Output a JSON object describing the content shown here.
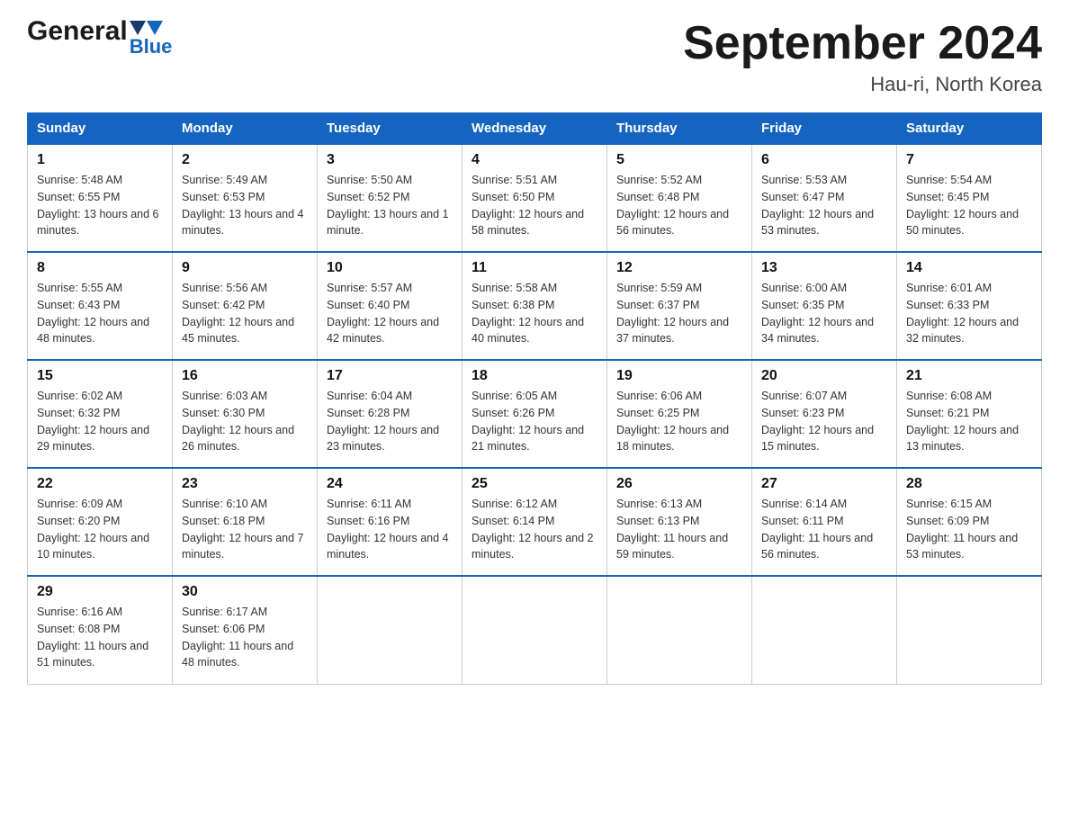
{
  "header": {
    "logo_general": "General",
    "logo_blue": "Blue",
    "title": "September 2024",
    "subtitle": "Hau-ri, North Korea"
  },
  "days_of_week": [
    "Sunday",
    "Monday",
    "Tuesday",
    "Wednesday",
    "Thursday",
    "Friday",
    "Saturday"
  ],
  "weeks": [
    [
      {
        "day": "1",
        "sunrise": "5:48 AM",
        "sunset": "6:55 PM",
        "daylight": "13 hours and 6 minutes."
      },
      {
        "day": "2",
        "sunrise": "5:49 AM",
        "sunset": "6:53 PM",
        "daylight": "13 hours and 4 minutes."
      },
      {
        "day": "3",
        "sunrise": "5:50 AM",
        "sunset": "6:52 PM",
        "daylight": "13 hours and 1 minute."
      },
      {
        "day": "4",
        "sunrise": "5:51 AM",
        "sunset": "6:50 PM",
        "daylight": "12 hours and 58 minutes."
      },
      {
        "day": "5",
        "sunrise": "5:52 AM",
        "sunset": "6:48 PM",
        "daylight": "12 hours and 56 minutes."
      },
      {
        "day": "6",
        "sunrise": "5:53 AM",
        "sunset": "6:47 PM",
        "daylight": "12 hours and 53 minutes."
      },
      {
        "day": "7",
        "sunrise": "5:54 AM",
        "sunset": "6:45 PM",
        "daylight": "12 hours and 50 minutes."
      }
    ],
    [
      {
        "day": "8",
        "sunrise": "5:55 AM",
        "sunset": "6:43 PM",
        "daylight": "12 hours and 48 minutes."
      },
      {
        "day": "9",
        "sunrise": "5:56 AM",
        "sunset": "6:42 PM",
        "daylight": "12 hours and 45 minutes."
      },
      {
        "day": "10",
        "sunrise": "5:57 AM",
        "sunset": "6:40 PM",
        "daylight": "12 hours and 42 minutes."
      },
      {
        "day": "11",
        "sunrise": "5:58 AM",
        "sunset": "6:38 PM",
        "daylight": "12 hours and 40 minutes."
      },
      {
        "day": "12",
        "sunrise": "5:59 AM",
        "sunset": "6:37 PM",
        "daylight": "12 hours and 37 minutes."
      },
      {
        "day": "13",
        "sunrise": "6:00 AM",
        "sunset": "6:35 PM",
        "daylight": "12 hours and 34 minutes."
      },
      {
        "day": "14",
        "sunrise": "6:01 AM",
        "sunset": "6:33 PM",
        "daylight": "12 hours and 32 minutes."
      }
    ],
    [
      {
        "day": "15",
        "sunrise": "6:02 AM",
        "sunset": "6:32 PM",
        "daylight": "12 hours and 29 minutes."
      },
      {
        "day": "16",
        "sunrise": "6:03 AM",
        "sunset": "6:30 PM",
        "daylight": "12 hours and 26 minutes."
      },
      {
        "day": "17",
        "sunrise": "6:04 AM",
        "sunset": "6:28 PM",
        "daylight": "12 hours and 23 minutes."
      },
      {
        "day": "18",
        "sunrise": "6:05 AM",
        "sunset": "6:26 PM",
        "daylight": "12 hours and 21 minutes."
      },
      {
        "day": "19",
        "sunrise": "6:06 AM",
        "sunset": "6:25 PM",
        "daylight": "12 hours and 18 minutes."
      },
      {
        "day": "20",
        "sunrise": "6:07 AM",
        "sunset": "6:23 PM",
        "daylight": "12 hours and 15 minutes."
      },
      {
        "day": "21",
        "sunrise": "6:08 AM",
        "sunset": "6:21 PM",
        "daylight": "12 hours and 13 minutes."
      }
    ],
    [
      {
        "day": "22",
        "sunrise": "6:09 AM",
        "sunset": "6:20 PM",
        "daylight": "12 hours and 10 minutes."
      },
      {
        "day": "23",
        "sunrise": "6:10 AM",
        "sunset": "6:18 PM",
        "daylight": "12 hours and 7 minutes."
      },
      {
        "day": "24",
        "sunrise": "6:11 AM",
        "sunset": "6:16 PM",
        "daylight": "12 hours and 4 minutes."
      },
      {
        "day": "25",
        "sunrise": "6:12 AM",
        "sunset": "6:14 PM",
        "daylight": "12 hours and 2 minutes."
      },
      {
        "day": "26",
        "sunrise": "6:13 AM",
        "sunset": "6:13 PM",
        "daylight": "11 hours and 59 minutes."
      },
      {
        "day": "27",
        "sunrise": "6:14 AM",
        "sunset": "6:11 PM",
        "daylight": "11 hours and 56 minutes."
      },
      {
        "day": "28",
        "sunrise": "6:15 AM",
        "sunset": "6:09 PM",
        "daylight": "11 hours and 53 minutes."
      }
    ],
    [
      {
        "day": "29",
        "sunrise": "6:16 AM",
        "sunset": "6:08 PM",
        "daylight": "11 hours and 51 minutes."
      },
      {
        "day": "30",
        "sunrise": "6:17 AM",
        "sunset": "6:06 PM",
        "daylight": "11 hours and 48 minutes."
      },
      null,
      null,
      null,
      null,
      null
    ]
  ]
}
